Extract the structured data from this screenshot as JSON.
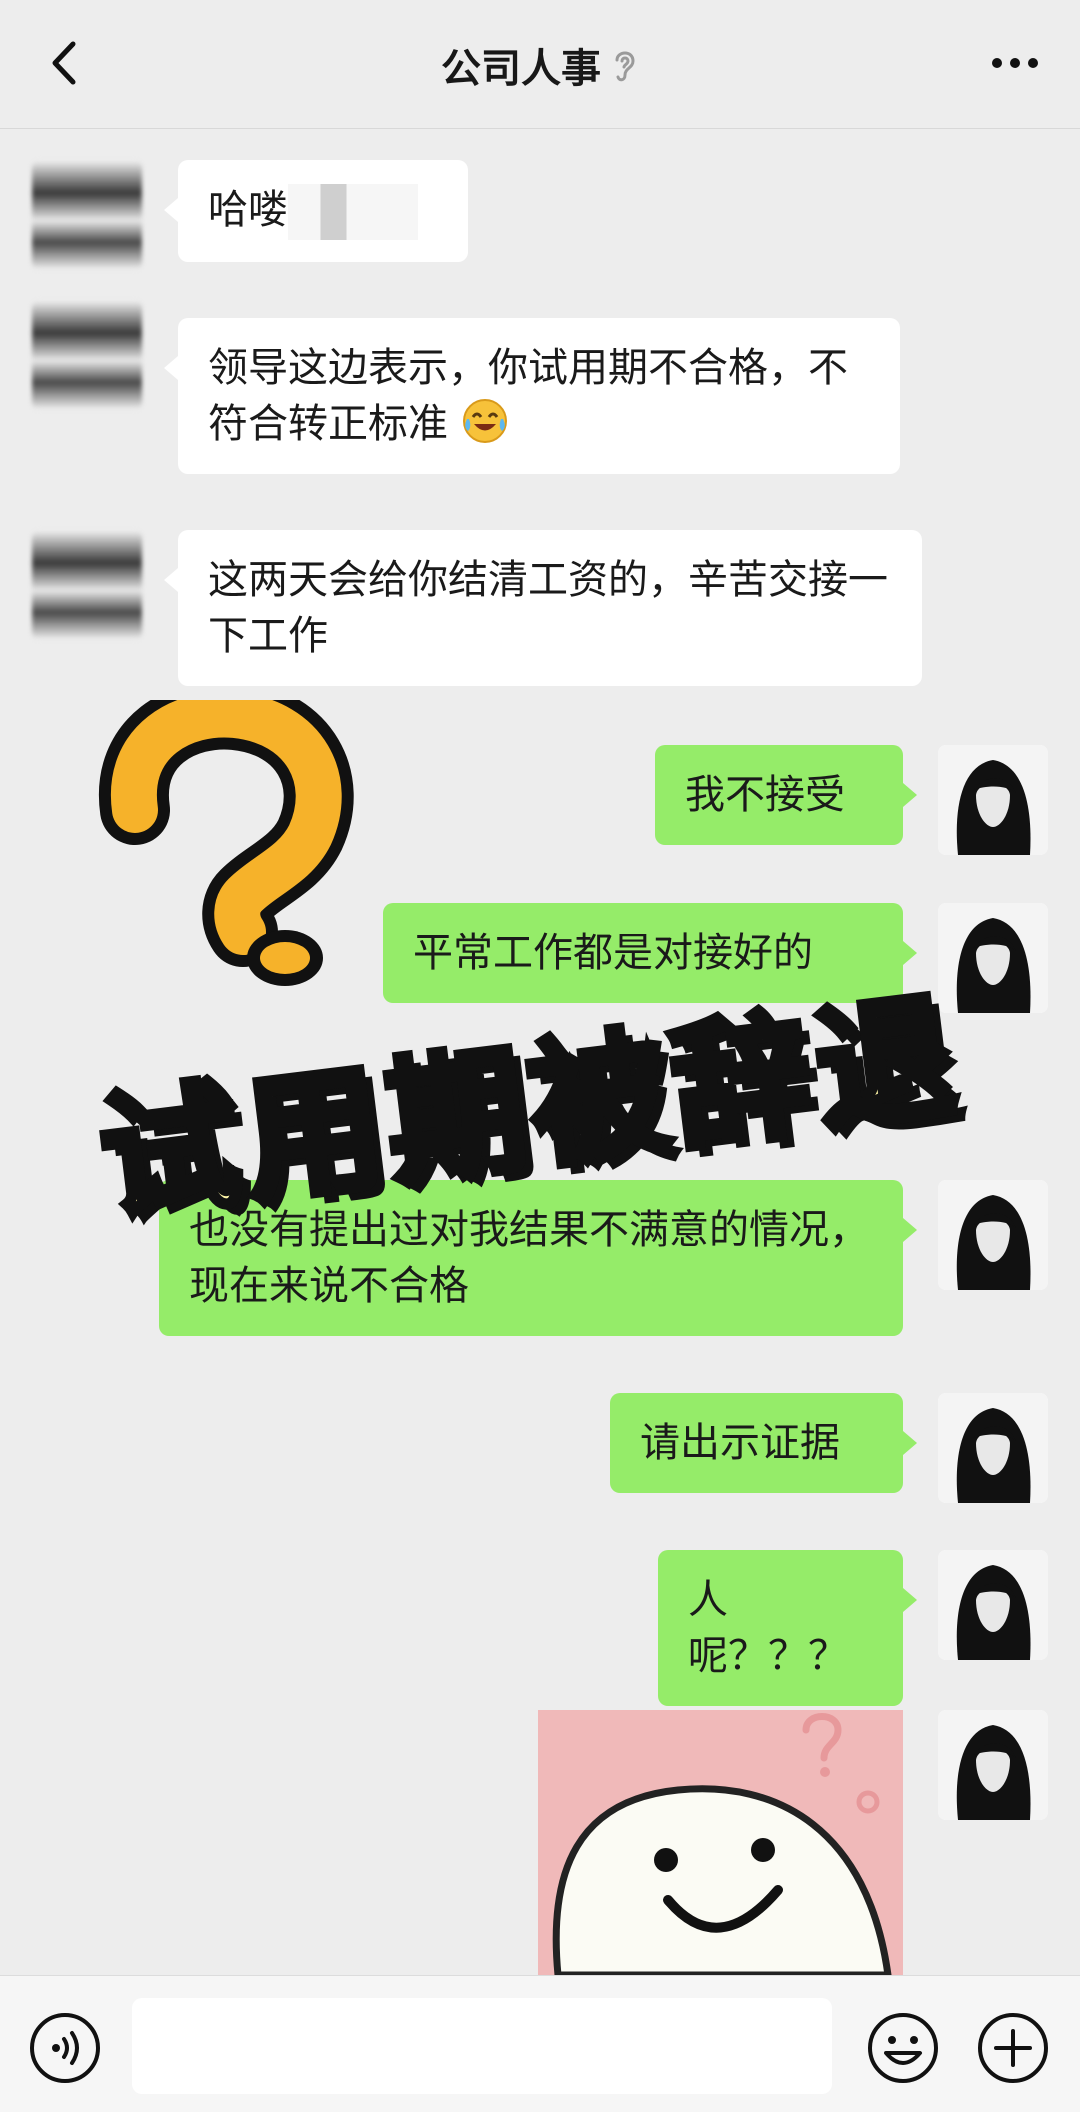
{
  "header": {
    "title": "公司人事",
    "back_icon": "chevron-left-icon",
    "muted_icon": "ear-icon",
    "more_icon": "more-horizontal-icon"
  },
  "messages": [
    {
      "from": "contact",
      "text": "哈喽"
    },
    {
      "from": "contact",
      "text": "领导这边表示，你试用期不合格，不符合转正标准",
      "emoji": "crying-laughing-emoji"
    },
    {
      "from": "contact",
      "text": "这两天会给你结清工资的，辛苦交接一下工作"
    },
    {
      "from": "me",
      "text": "我不接受"
    },
    {
      "from": "me",
      "text": "平常工作都是对接好的"
    },
    {
      "from": "me",
      "text": "也没有提出过对我结果不满意的情况，现在来说不合格"
    },
    {
      "from": "me",
      "text": "请出示证据"
    },
    {
      "from": "me",
      "text": "人呢？？？"
    },
    {
      "from": "me",
      "type": "sticker",
      "sticker": "confused-smiling-face-sticker"
    }
  ],
  "overlay": {
    "title": "试用期被辞退",
    "icon": "question-mark-icon"
  },
  "bottom_bar": {
    "voice_icon": "voice-icon",
    "emoji_icon": "emoji-icon",
    "plus_icon": "plus-icon",
    "input_value": ""
  },
  "colors": {
    "background": "#ededed",
    "incoming_bubble": "#ffffff",
    "outgoing_bubble": "#95ec69",
    "overlay_text": "#fff6a8",
    "question_mark": "#f6b22a"
  }
}
